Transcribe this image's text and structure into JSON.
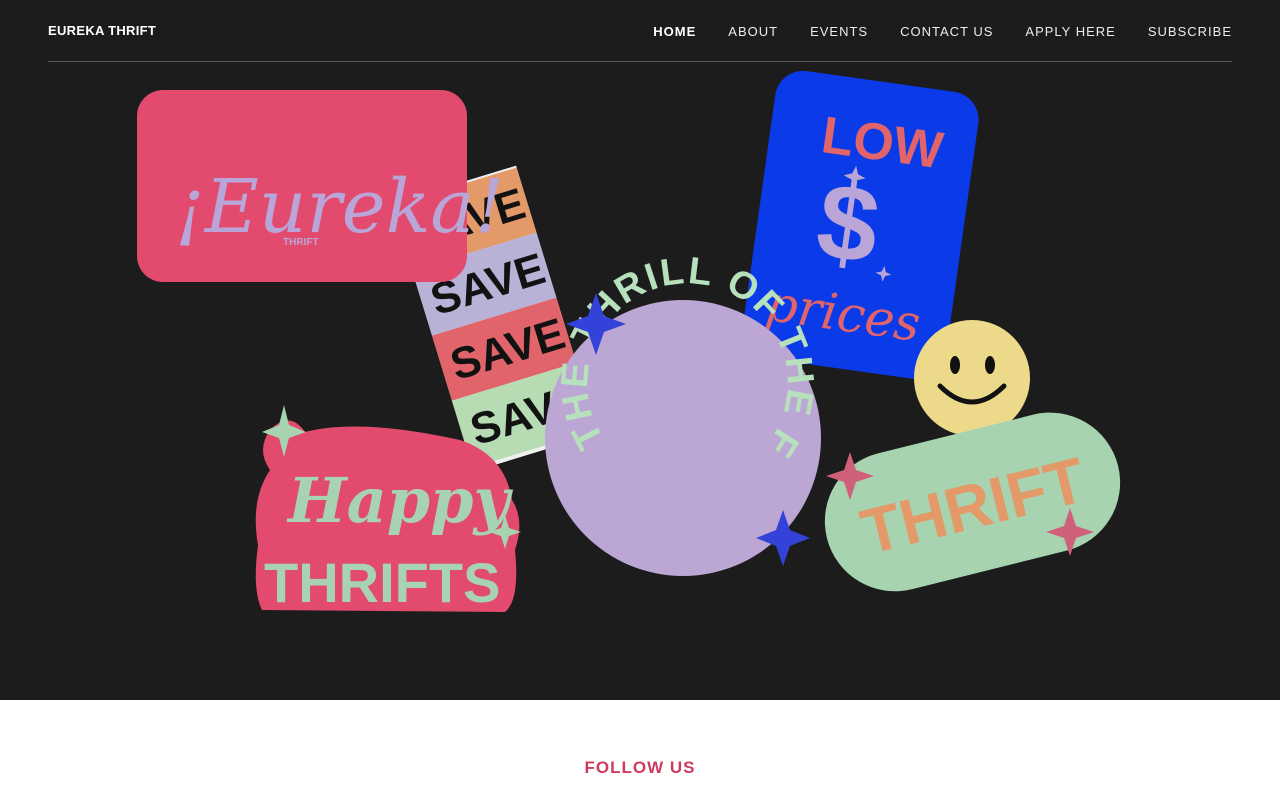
{
  "header": {
    "brand": "EUREKA THRIFT",
    "nav": [
      {
        "label": "HOME",
        "active": true
      },
      {
        "label": "ABOUT"
      },
      {
        "label": "EVENTS"
      },
      {
        "label": "CONTACT US"
      },
      {
        "label": "APPLY HERE"
      },
      {
        "label": "SUBSCRIBE"
      }
    ]
  },
  "hero": {
    "stickers": {
      "eureka_title": "¡Eureka!",
      "eureka_sub": "THRIFT",
      "save_words": [
        "SAVE",
        "SAVE",
        "SAVE",
        "SAVE"
      ],
      "low": "LOW",
      "dollar": "$",
      "prices": "prices",
      "circle_text": "THE THRILL OF THE FIND",
      "happy": "Happy",
      "thrifts": "THRIFTS",
      "thrift": "THRIFT"
    },
    "colors": {
      "background": "#1c1c1c",
      "pink": "#e24a6e",
      "lavender": "#b9a5d8",
      "blue": "#0b3be8",
      "mint": "#a7d3b0",
      "orange": "#e49a68",
      "yellow": "#ecd98a",
      "spark_blue": "#3342d8"
    }
  },
  "footer": {
    "follow": "FOLLOW US"
  }
}
